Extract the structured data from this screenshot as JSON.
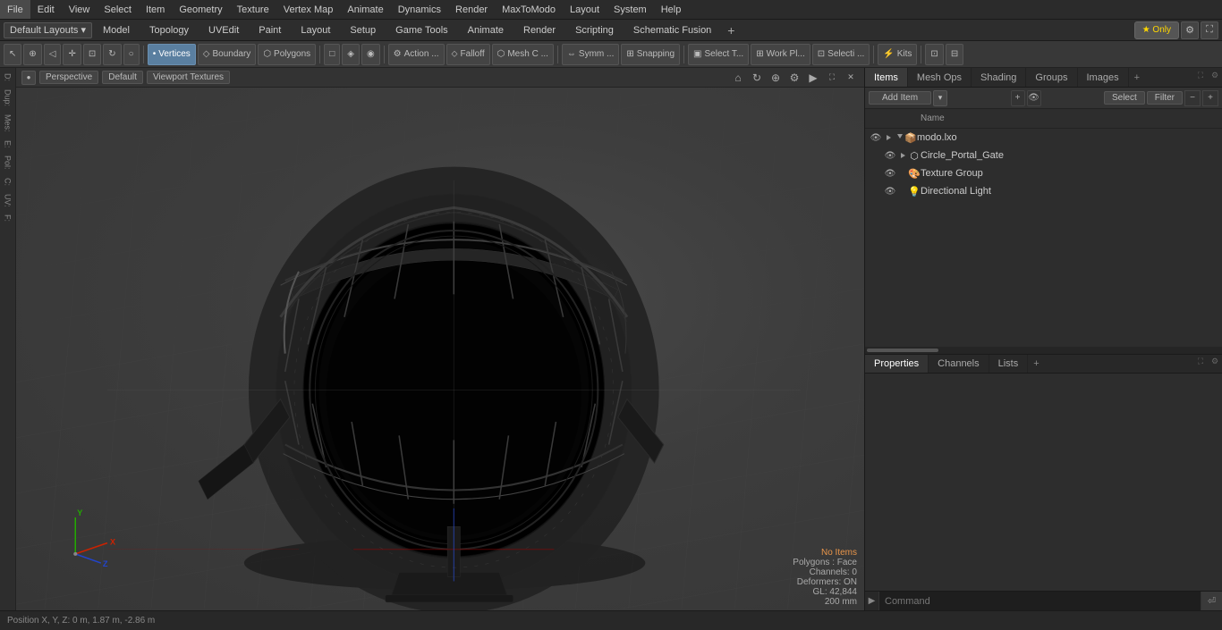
{
  "menubar": {
    "items": [
      {
        "label": "File",
        "id": "file"
      },
      {
        "label": "Edit",
        "id": "edit"
      },
      {
        "label": "View",
        "id": "view"
      },
      {
        "label": "Select",
        "id": "select"
      },
      {
        "label": "Item",
        "id": "item"
      },
      {
        "label": "Geometry",
        "id": "geometry"
      },
      {
        "label": "Texture",
        "id": "texture"
      },
      {
        "label": "Vertex Map",
        "id": "vertex-map"
      },
      {
        "label": "Animate",
        "id": "animate"
      },
      {
        "label": "Dynamics",
        "id": "dynamics"
      },
      {
        "label": "Render",
        "id": "render"
      },
      {
        "label": "MaxToModo",
        "id": "maxtomode"
      },
      {
        "label": "Layout",
        "id": "layout"
      },
      {
        "label": "System",
        "id": "system"
      },
      {
        "label": "Help",
        "id": "help"
      }
    ]
  },
  "layout_bar": {
    "dropdown_label": "Default Layouts ▾",
    "tabs": [
      {
        "label": "Model",
        "active": false
      },
      {
        "label": "Topology",
        "active": false
      },
      {
        "label": "UVEdit",
        "active": false
      },
      {
        "label": "Paint",
        "active": false
      },
      {
        "label": "Layout",
        "active": false
      },
      {
        "label": "Setup",
        "active": false
      },
      {
        "label": "Game Tools",
        "active": false
      },
      {
        "label": "Animate",
        "active": false
      },
      {
        "label": "Render",
        "active": false
      },
      {
        "label": "Scripting",
        "active": false
      },
      {
        "label": "Schematic Fusion",
        "active": false
      }
    ],
    "star_label": "★ Only",
    "plus_label": "+"
  },
  "toolbar": {
    "items": [
      {
        "label": "",
        "id": "tb-arrow",
        "icon": "↖"
      },
      {
        "label": "",
        "id": "tb-globe",
        "icon": "⊕"
      },
      {
        "label": "",
        "id": "tb-cone",
        "icon": "△"
      },
      {
        "label": "",
        "id": "tb-move",
        "icon": "✛"
      },
      {
        "label": "",
        "id": "tb-scale",
        "icon": "⊡"
      },
      {
        "label": "",
        "id": "tb-rotate",
        "icon": "↻"
      },
      {
        "label": "",
        "id": "tb-circle",
        "icon": "○"
      },
      {
        "label": "Vertices",
        "id": "tb-vertices",
        "icon": "•"
      },
      {
        "label": "Boundary",
        "id": "tb-boundary",
        "icon": "◇"
      },
      {
        "label": "Polygons",
        "id": "tb-polygons",
        "icon": "⬡"
      },
      {
        "label": "",
        "id": "tb-sel1",
        "icon": "□"
      },
      {
        "label": "",
        "id": "tb-sel2",
        "icon": "◈"
      },
      {
        "label": "",
        "id": "tb-sel3",
        "icon": "◉"
      },
      {
        "label": "Action ...",
        "id": "tb-action",
        "icon": "⚙"
      },
      {
        "label": "Falloff",
        "id": "tb-falloff",
        "icon": "⬦"
      },
      {
        "label": "Mesh C ...",
        "id": "tb-mesh",
        "icon": "⬡"
      },
      {
        "label": "Symm ...",
        "id": "tb-symm",
        "icon": "⇔"
      },
      {
        "label": "Snapping",
        "id": "tb-snap",
        "icon": "🧲"
      },
      {
        "label": "Select T...",
        "id": "tb-select-t",
        "icon": "▣"
      },
      {
        "label": "Work Pl...",
        "id": "tb-workpl",
        "icon": "⊞"
      },
      {
        "label": "Selecti ...",
        "id": "tb-selecti",
        "icon": "⊡"
      },
      {
        "label": "Kits",
        "id": "tb-kits",
        "icon": "⚡"
      },
      {
        "label": "",
        "id": "tb-view1",
        "icon": "⊡"
      },
      {
        "label": "",
        "id": "tb-view2",
        "icon": "⊟"
      }
    ]
  },
  "viewport": {
    "perspective_label": "Perspective",
    "shading_label": "Default",
    "display_label": "Viewport Textures",
    "navigation_icons": [
      "↔",
      "↻",
      "🔍",
      "⚙",
      "▶"
    ],
    "status": {
      "no_items": "No Items",
      "polygons": "Polygons : Face",
      "channels": "Channels: 0",
      "deformers": "Deformers: ON",
      "gl": "GL: 42,844",
      "size": "200 mm"
    },
    "position_label": "Position X, Y, Z:  0 m, 1.87 m, -2.86 m"
  },
  "left_sidebar": {
    "items": [
      {
        "label": "D:",
        "id": "sb-d"
      },
      {
        "label": "Dup:",
        "id": "sb-dup"
      },
      {
        "label": "Mes:",
        "id": "sb-mes"
      },
      {
        "label": "E:",
        "id": "sb-e"
      },
      {
        "label": "Pol:",
        "id": "sb-pol"
      },
      {
        "label": "C:",
        "id": "sb-c"
      },
      {
        "label": "UV:",
        "id": "sb-uv"
      },
      {
        "label": "F:",
        "id": "sb-f"
      }
    ]
  },
  "right_panel": {
    "tabs": [
      {
        "label": "Items",
        "active": true
      },
      {
        "label": "Mesh Ops",
        "active": false
      },
      {
        "label": "Shading",
        "active": false
      },
      {
        "label": "Groups",
        "active": false
      },
      {
        "label": "Images",
        "active": false
      }
    ],
    "add_item_label": "Add Item",
    "add_item_dropdown": "▾",
    "select_btn": "Select",
    "filter_btn": "Filter",
    "collapse_btn": "−",
    "expand_btn": "+",
    "col_name": "Name",
    "items_list": [
      {
        "id": "modo-bxo",
        "label": "modo.lxo",
        "level": 0,
        "icon": "📦",
        "eye": true,
        "expandable": true,
        "expanded": true,
        "children": [
          {
            "id": "circle-portal",
            "label": "Circle_Portal_Gate",
            "level": 1,
            "icon": "⬡",
            "eye": true,
            "expandable": true,
            "expanded": false
          },
          {
            "id": "texture-group",
            "label": "Texture Group",
            "level": 1,
            "icon": "🎨",
            "eye": true,
            "expandable": false
          },
          {
            "id": "dir-light",
            "label": "Directional Light",
            "level": 1,
            "icon": "💡",
            "eye": true,
            "expandable": false
          }
        ]
      }
    ]
  },
  "prop_panel": {
    "tabs": [
      {
        "label": "Properties",
        "active": true
      },
      {
        "label": "Channels",
        "active": false
      },
      {
        "label": "Lists",
        "active": false
      }
    ],
    "add_btn": "+"
  },
  "command_bar": {
    "placeholder": "Command",
    "exec_icon": "⏎"
  },
  "bottom_status": {
    "text": "Position X, Y, Z:  0 m, 1.87 m, -2.86 m"
  },
  "colors": {
    "accent_blue": "#3a6ea8",
    "active_tab": "#5a5a5a",
    "status_orange": "#e8954a"
  }
}
